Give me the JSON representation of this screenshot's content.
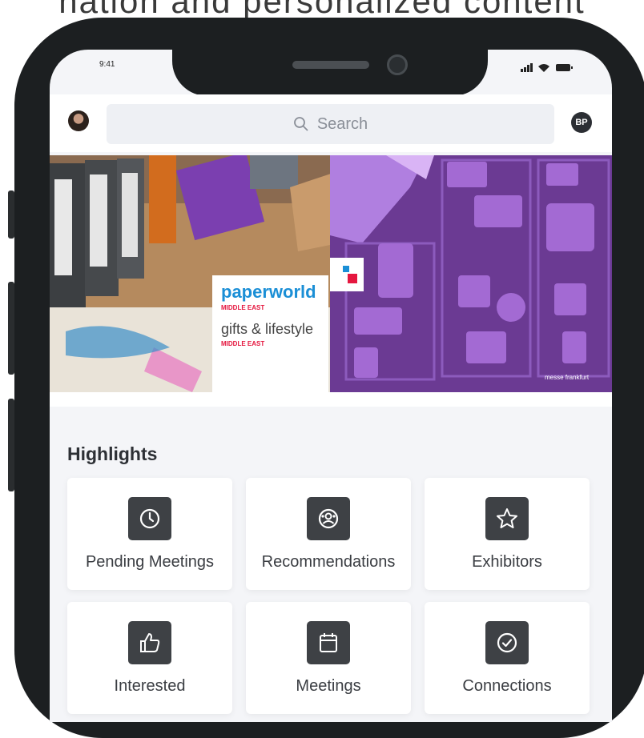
{
  "caption": "nation and personalized content",
  "status_bar": {
    "time": "9:41"
  },
  "search": {
    "placeholder": "Search"
  },
  "profile_badge": {
    "initials": "BP"
  },
  "banner": {
    "brand_primary": "paperworld",
    "brand_primary_sub": "MIDDLE EAST",
    "brand_secondary": "gifts & lifestyle",
    "brand_secondary_sub": "MIDDLE EAST",
    "watermark": "messe frankfurt"
  },
  "highlights": {
    "title": "Highlights",
    "items": [
      {
        "label": "Pending Meetings",
        "icon": "clock-icon"
      },
      {
        "label": "Recommendations",
        "icon": "recommendations-icon"
      },
      {
        "label": "Exhibitors",
        "icon": "star-icon"
      },
      {
        "label": "Interested",
        "icon": "thumbs-up-icon"
      },
      {
        "label": "Meetings",
        "icon": "calendar-icon"
      },
      {
        "label": "Connections",
        "icon": "check-circle-icon"
      }
    ]
  },
  "colors": {
    "phone_frame": "#1c1f21",
    "tile_icon_bg": "#3e4145",
    "brand_blue": "#1b8fd6",
    "brand_red": "#e5173f",
    "banner_purple": "#6b3a93"
  }
}
